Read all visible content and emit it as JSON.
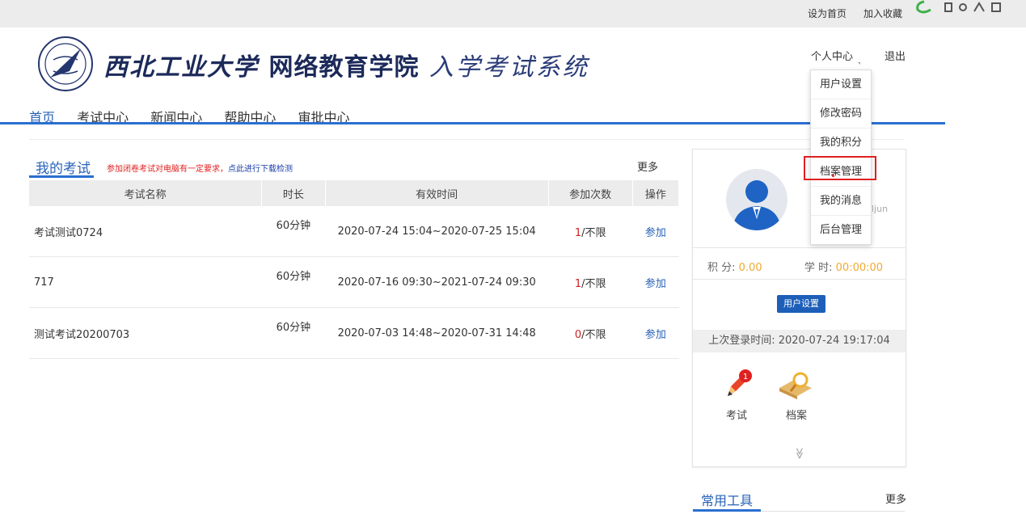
{
  "topbar": {
    "set_home": "设为首页",
    "add_favorite": "加入收藏"
  },
  "header": {
    "title_main": "西北工业大学",
    "title_sub": "网络教育学院",
    "title_sys": "入学考试系统",
    "user_center": "个人中心",
    "logout": "退出"
  },
  "nav": {
    "items": [
      "首页",
      "考试中心",
      "新闻中心",
      "帮助中心",
      "审批中心"
    ]
  },
  "my_exams": {
    "title": "我的考试",
    "notice": "参加闭卷考试对电脑有一定要求，",
    "notice_link": "点此进行下载检测",
    "more": "更多",
    "columns": [
      "考试名称",
      "时长",
      "有效时间",
      "参加次数",
      "操作"
    ],
    "rows": [
      {
        "name": "考试测试0724",
        "duration": "60分钟",
        "time": "2020-07-24 15:04~2020-07-25 15:04",
        "count": "1",
        "limit": "/不限",
        "action": "参加"
      },
      {
        "name": "717",
        "duration": "60分钟",
        "time": "2020-07-16 09:30~2021-07-24 09:30",
        "count": "1",
        "limit": "/不限",
        "action": "参加"
      },
      {
        "name": "测试考试20200703",
        "duration": "60分钟",
        "time": "2020-07-03 14:48~2020-07-31 14:48",
        "count": "0",
        "limit": "/不限",
        "action": "参加"
      }
    ]
  },
  "profile": {
    "username_fragment": "ljun",
    "score_label": "积 分:",
    "score_value": "0.00",
    "hours_label": "学 时:",
    "hours_value": "00:00:00",
    "settings_button": "用户设置",
    "last_login": "上次登录时间: 2020-07-24 19:17:04",
    "exam_badge": "1",
    "shortcut_exam": "考试",
    "shortcut_file": "档案",
    "expand_glyph": "≫"
  },
  "tools": {
    "title": "常用工具",
    "more": "更多"
  },
  "dropdown": {
    "items": [
      "用户设置",
      "修改密码",
      "我的积分",
      "档案管理",
      "我的消息",
      "后台管理"
    ],
    "highlighted_index": 3
  },
  "colors": {
    "accent": "#2a6fd0",
    "highlight": "#e02020",
    "value": "#f0a830"
  }
}
